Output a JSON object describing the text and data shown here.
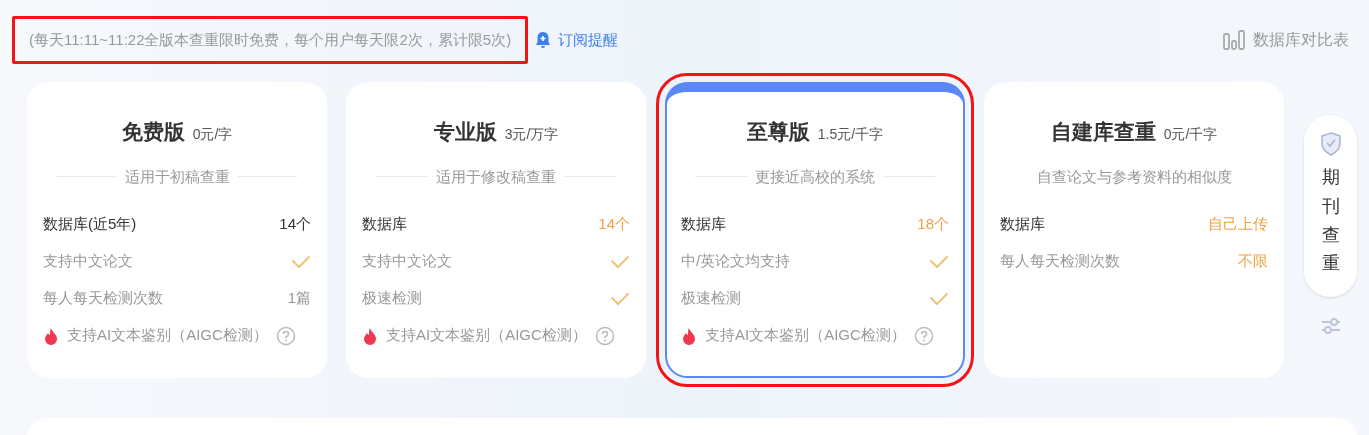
{
  "notice": {
    "text": "(每天11:11~11:22全版本查重限时免费，每个用户每天限2次，累计限5次)",
    "highlighted": true
  },
  "subscribe": {
    "label": "订阅提醒"
  },
  "compare": {
    "label": "数据库对比表"
  },
  "plans": [
    {
      "name": "免费版",
      "price": "0元/字",
      "subtitle": "适用于初稿查重",
      "ruled": true,
      "selected": false,
      "highlighted": false,
      "rows": [
        {
          "kind": "value",
          "label": "数据库(近5年)",
          "primary": true,
          "value": "14个",
          "accent": false
        },
        {
          "kind": "check",
          "label": "支持中文论文",
          "primary": false
        },
        {
          "kind": "value",
          "label": "每人每天检测次数",
          "primary": false,
          "value": "1篇",
          "accent": false
        },
        {
          "kind": "aigc",
          "label": "支持AI文本鉴别（AIGC检测）",
          "primary": false
        }
      ]
    },
    {
      "name": "专业版",
      "price": "3元/万字",
      "subtitle": "适用于修改稿查重",
      "ruled": true,
      "selected": false,
      "highlighted": false,
      "rows": [
        {
          "kind": "value",
          "label": "数据库",
          "primary": true,
          "value": "14个",
          "accent": true
        },
        {
          "kind": "check",
          "label": "支持中文论文",
          "primary": false
        },
        {
          "kind": "check",
          "label": "极速检测",
          "primary": false
        },
        {
          "kind": "aigc",
          "label": "支持AI文本鉴别（AIGC检测）",
          "primary": false
        }
      ]
    },
    {
      "name": "至尊版",
      "price": "1.5元/千字",
      "subtitle": "更接近高校的系统",
      "ruled": true,
      "selected": true,
      "highlighted": true,
      "rows": [
        {
          "kind": "value",
          "label": "数据库",
          "primary": true,
          "value": "18个",
          "accent": true
        },
        {
          "kind": "check",
          "label": "中/英论文均支持",
          "primary": false
        },
        {
          "kind": "check",
          "label": "极速检测",
          "primary": false
        },
        {
          "kind": "aigc",
          "label": "支持AI文本鉴别（AIGC检测）",
          "primary": false
        }
      ]
    },
    {
      "name": "自建库查重",
      "price": "0元/千字",
      "subtitle": "自查论文与参考资料的相似度",
      "ruled": false,
      "selected": false,
      "highlighted": false,
      "rows": [
        {
          "kind": "value",
          "label": "数据库",
          "primary": true,
          "value": "自己上传",
          "accent": true
        },
        {
          "kind": "value",
          "label": "每人每天检测次数",
          "primary": false,
          "value": "不限",
          "accent": true
        }
      ]
    }
  ],
  "side_tab": {
    "label": "期刊查重"
  }
}
